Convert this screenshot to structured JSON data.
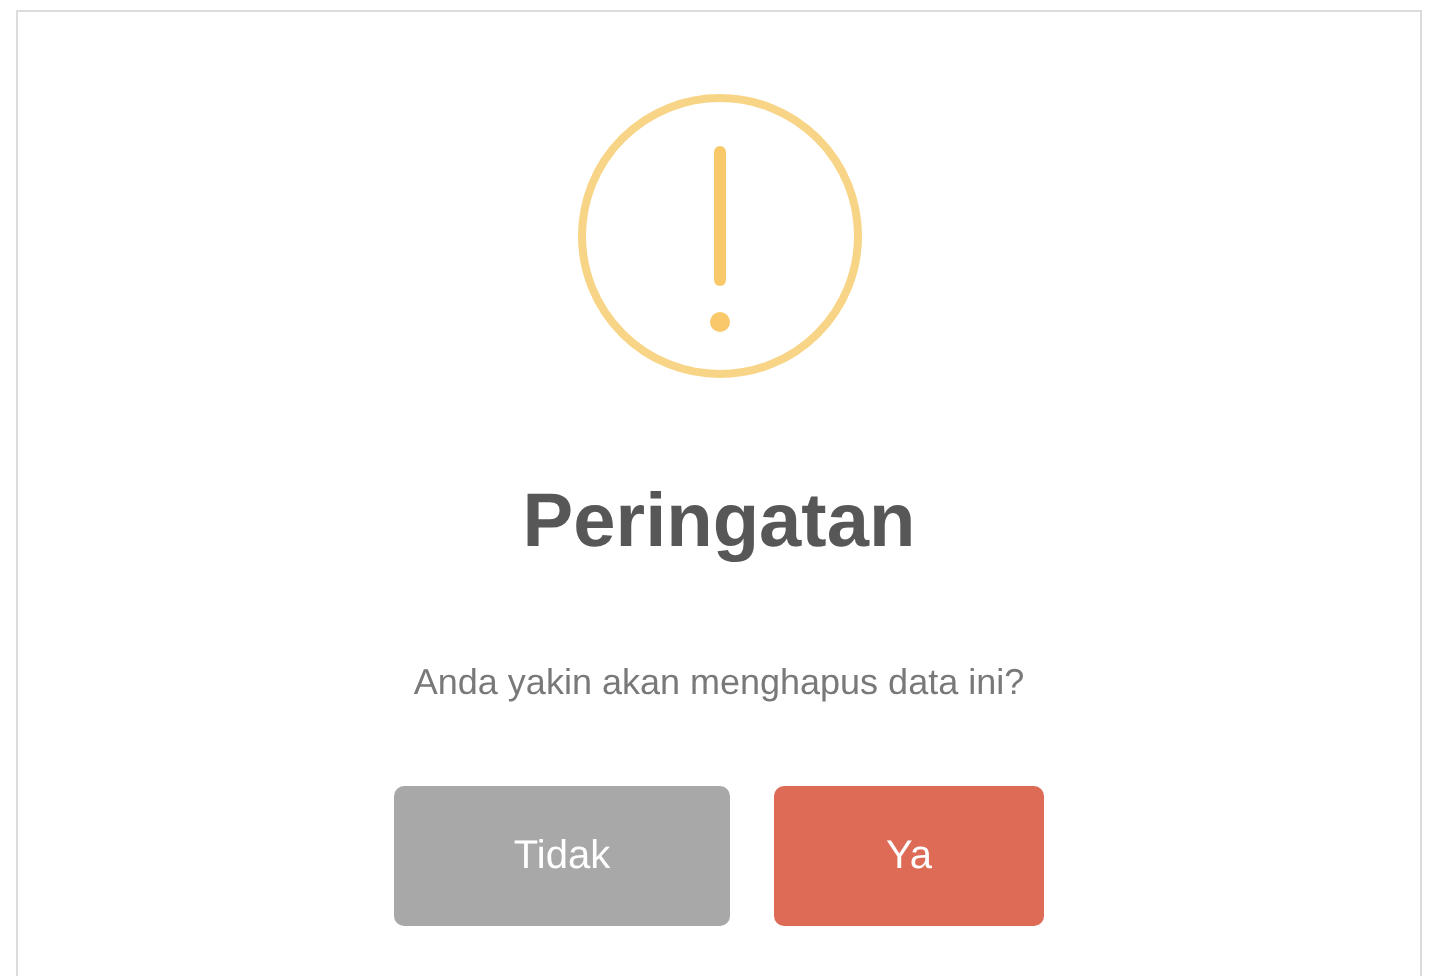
{
  "dialog": {
    "icon": {
      "kind": "warning"
    },
    "title": "Peringatan",
    "message": "Anda yakin akan menghapus data ini?",
    "buttons": [
      {
        "label": "Tidak",
        "kind": "cancel"
      },
      {
        "label": "Ya",
        "kind": "confirm"
      }
    ]
  }
}
